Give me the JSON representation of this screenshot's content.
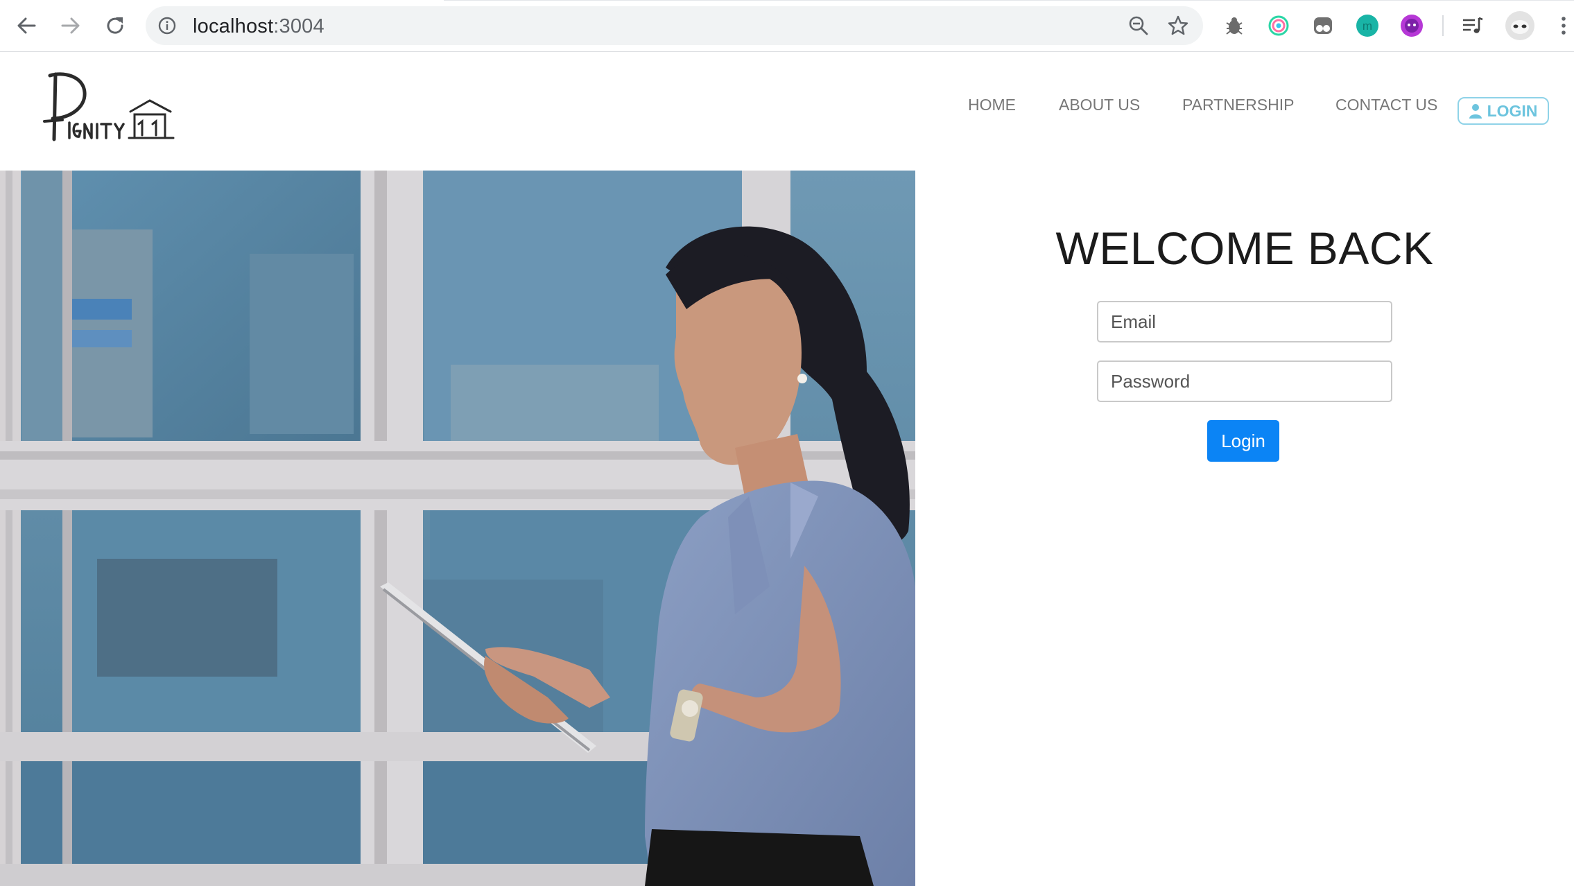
{
  "browser": {
    "url_host": "localhost",
    "url_port": ":3004",
    "icons": {
      "back": "arrow-left-icon",
      "forward": "arrow-right-icon",
      "reload": "reload-icon",
      "site_info": "info-icon",
      "zoom": "zoom-out-icon",
      "bookmark": "star-icon",
      "menu": "kebab-menu-icon"
    },
    "extensions": [
      "bug-extension",
      "ring-extension",
      "ghost-extension",
      "m-extension",
      "purple-extension",
      "media-control",
      "profile-avatar"
    ]
  },
  "header": {
    "logo_text": "Dignity",
    "nav": {
      "home": "HOME",
      "about": "ABOUT US",
      "partnership": "PARTNERSHIP",
      "contact": "CONTACT US"
    },
    "login_label": "LOGIN",
    "login_icon": "user-icon",
    "accent_color": "#6cc4de"
  },
  "form": {
    "title": "WELCOME BACK",
    "email_placeholder": "Email",
    "email_value": "",
    "password_placeholder": "Password",
    "password_value": "",
    "submit_label": "Login",
    "button_color": "#0b84f5"
  }
}
